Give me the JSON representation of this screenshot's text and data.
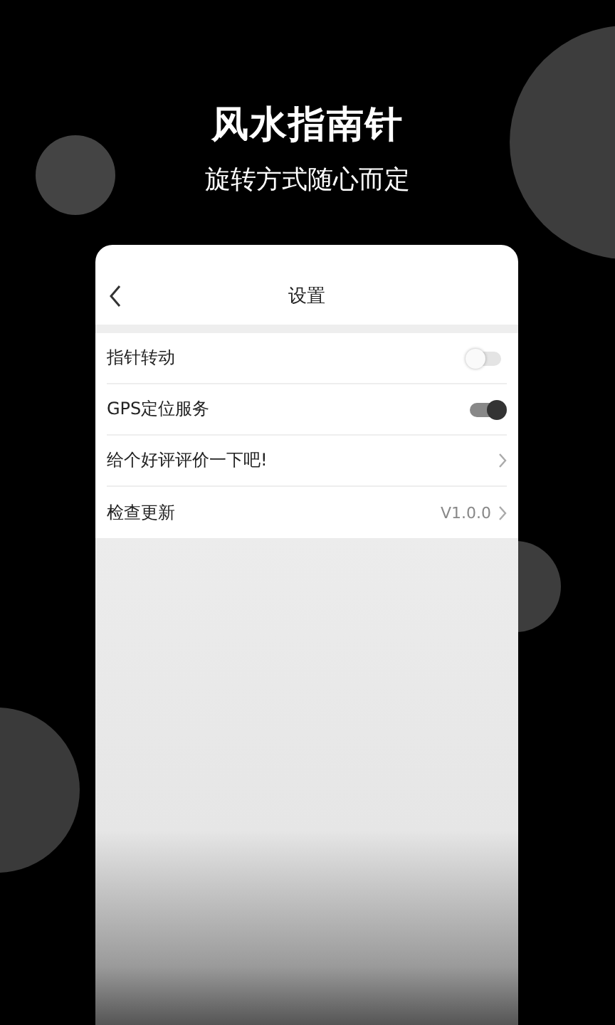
{
  "headline": "风水指南针",
  "subtitle": "旋转方式随心而定",
  "screen": {
    "title": "设置",
    "settings": [
      {
        "kind": "toggle",
        "label": "指针转动",
        "on": false
      },
      {
        "kind": "toggle",
        "label": "GPS定位服务",
        "on": true
      },
      {
        "kind": "link",
        "label": "给个好评评价一下吧!"
      },
      {
        "kind": "link",
        "label": "检查更新",
        "value": "V1.0.0"
      }
    ]
  }
}
